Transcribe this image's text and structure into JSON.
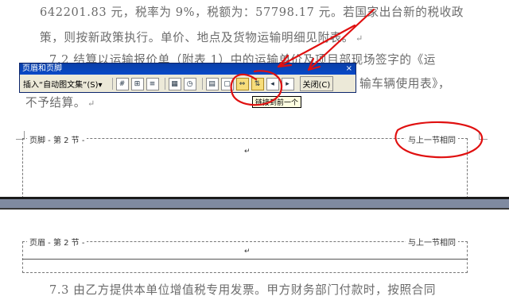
{
  "doc": {
    "line1": "642201.83 元，税率为 9%，税额为：57798.17 元。若国家出台新的税收政",
    "line2": "策，则按新政策执行。单价、地点及货物运输明细见附表。",
    "line3a": "7.2 结算以运输报价单（附表 1）中的运输单价及项目部现场签字的《运",
    "line3b": "输车辆使用表》，",
    "line4": "不予结算。",
    "line5": "7.3 由乙方提供本单位增值税专用发票。甲方财务部门付款时，按照合同",
    "para_mark": "↵"
  },
  "toolbar": {
    "title": "页眉和页脚",
    "close_x": "×",
    "insert_autotext": "插入“自动图文集”(S)▾",
    "close_label": "关闭(C)",
    "tooltip": "链接到前一个"
  },
  "footer_section": {
    "label": "页脚 - 第 2 节 -",
    "same_as_previous": "与上一节相同"
  },
  "header_section": {
    "label": "页眉 - 第 2 节 -",
    "same_as_previous": "与上一节相同"
  },
  "colors": {
    "annotation_red": "#e01010",
    "toolbar_title": "#0a3fa8",
    "highlight_button": "#f7dd7a"
  },
  "icons": [
    "insert-page-number-icon",
    "insert-page-count-icon",
    "format-page-number-icon",
    "insert-date-icon",
    "insert-time-icon",
    "page-setup-icon",
    "show-hide-text-icon",
    "link-to-previous-icon",
    "switch-header-footer-icon",
    "show-previous-icon",
    "show-next-icon"
  ]
}
